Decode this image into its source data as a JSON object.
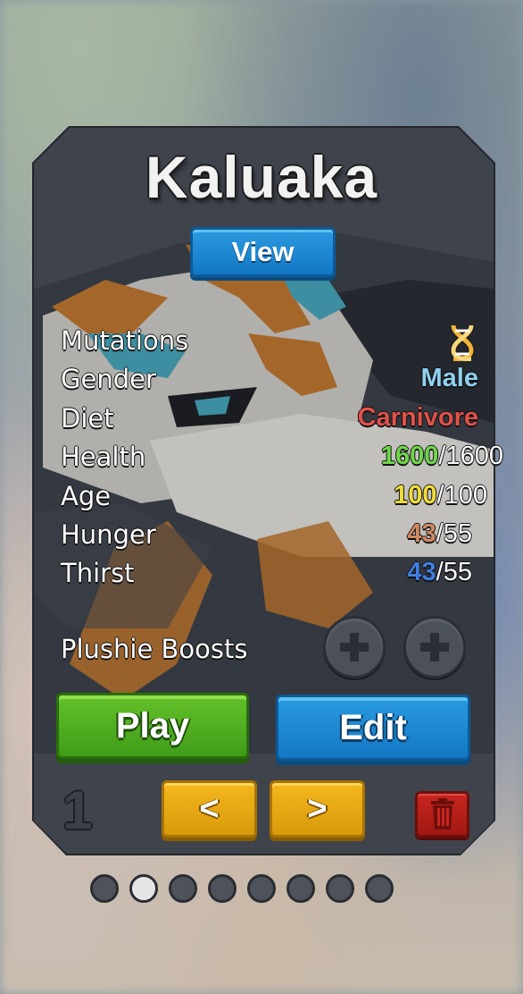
{
  "dino": {
    "name": "Kaluaka",
    "view_label": "View"
  },
  "stats": {
    "mutations_label": "Mutations",
    "mutation_icon": "dna-icon",
    "gender_label": "Gender",
    "gender_value": "Male",
    "diet_label": "Diet",
    "diet_value": "Carnivore",
    "health_label": "Health",
    "health_current": "1600",
    "health_max": "/1600",
    "age_label": "Age",
    "age_current": "100",
    "age_max": "/100",
    "hunger_label": "Hunger",
    "hunger_current": "43",
    "hunger_max": "/55",
    "thirst_label": "Thirst",
    "thirst_current": "43",
    "thirst_max": "/55"
  },
  "boosts": {
    "label": "Plushie Boosts",
    "slots": [
      "plus-icon",
      "plus-icon"
    ]
  },
  "actions": {
    "play_label": "Play",
    "edit_label": "Edit",
    "prev_label": "<",
    "next_label": ">",
    "delete_icon": "trash-icon"
  },
  "slot_number": "1",
  "pagination": {
    "total": 8,
    "active_index": 1
  },
  "colors": {
    "gender": "#8fd0ef",
    "diet": "#e0524a",
    "health": "#6fd649",
    "age": "#f2dd3a",
    "hunger": "#d08a62",
    "thirst": "#3f7fe0"
  }
}
